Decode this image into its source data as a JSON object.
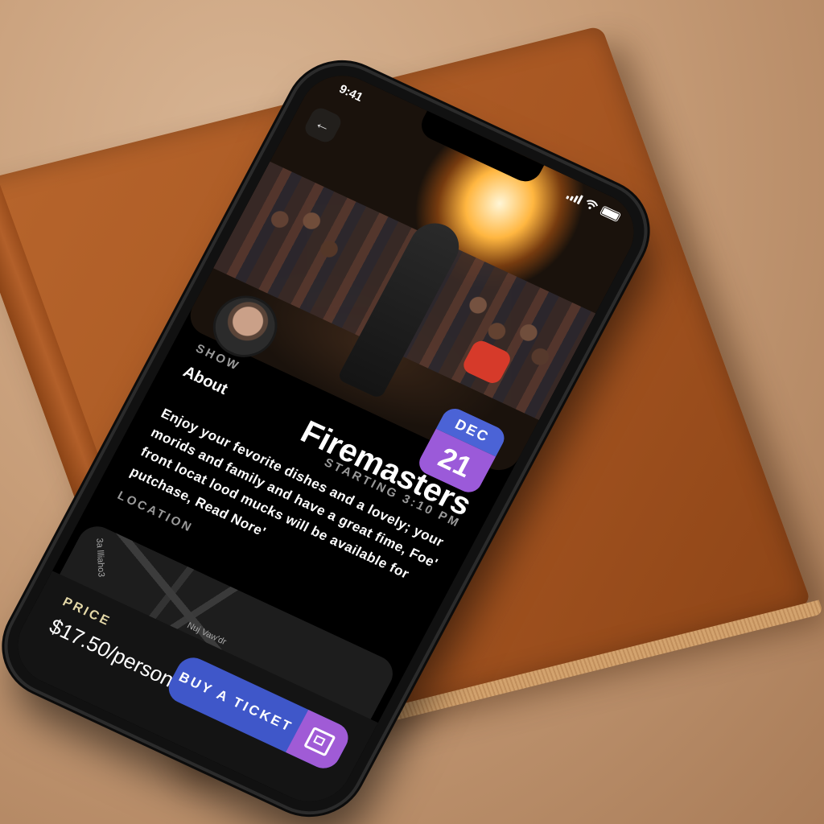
{
  "status_bar": {
    "time": "9:41"
  },
  "event": {
    "category_label": "SHOW",
    "title": "Firemasters",
    "about_heading": "About",
    "start_time": "STARTING 3:10 PM",
    "date": {
      "month": "DEC",
      "day": "21"
    },
    "description": "Enjoy your fevorite dishes and a lovely; your morids and family and have a great fime, Foe' front locat lood mucks will be available for putchase, Read Nore'"
  },
  "location": {
    "label": "LOCATION",
    "street_labels": [
      "Nuj Vaw'dr",
      "3a llliaho3",
      "ela"
    ]
  },
  "purchase": {
    "price_label": "PRICE",
    "price_value": "$17.50/person",
    "buy_label": "BUY A TICKET"
  },
  "icons": {
    "back": "back-arrow-icon",
    "ticket": "ticket-icon",
    "signal": "cell-signal-icon",
    "wifi": "wifi-icon",
    "battery": "battery-icon"
  },
  "colors": {
    "accent_blue": "#3f57c9",
    "accent_purple": "#a05bd6",
    "price_label": "#e5d9a8"
  }
}
